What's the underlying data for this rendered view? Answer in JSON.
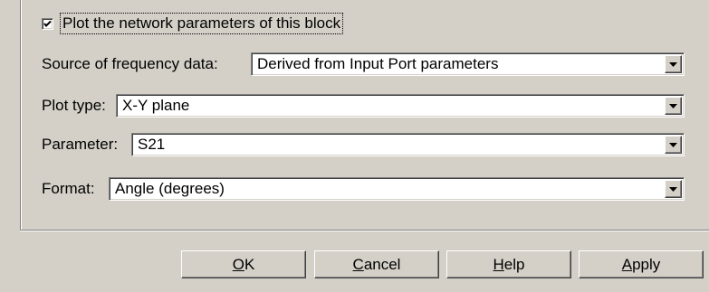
{
  "checkbox": {
    "label": "Plot the network parameters of this block",
    "checked": true
  },
  "fields": {
    "source": {
      "label": "Source of frequency data:",
      "value": "Derived from Input Port parameters"
    },
    "plot_type": {
      "label": "Plot type:",
      "value": "X-Y plane"
    },
    "parameter": {
      "label": "Parameter:",
      "value": "S21"
    },
    "format": {
      "label": "Format:",
      "value": "Angle (degrees)"
    }
  },
  "buttons": {
    "ok": {
      "mnemonic": "O",
      "rest": "K"
    },
    "cancel": {
      "mnemonic": "C",
      "rest": "ancel"
    },
    "help": {
      "mnemonic": "H",
      "rest": "elp"
    },
    "apply": {
      "mnemonic": "A",
      "rest": "pply"
    }
  },
  "icons": {
    "checkmark": "checkmark-icon",
    "dropdown": "chevron-down-icon"
  },
  "colors": {
    "dialog_bg": "#d4d0c8",
    "field_bg": "#ffffff",
    "shadow": "#808080"
  }
}
